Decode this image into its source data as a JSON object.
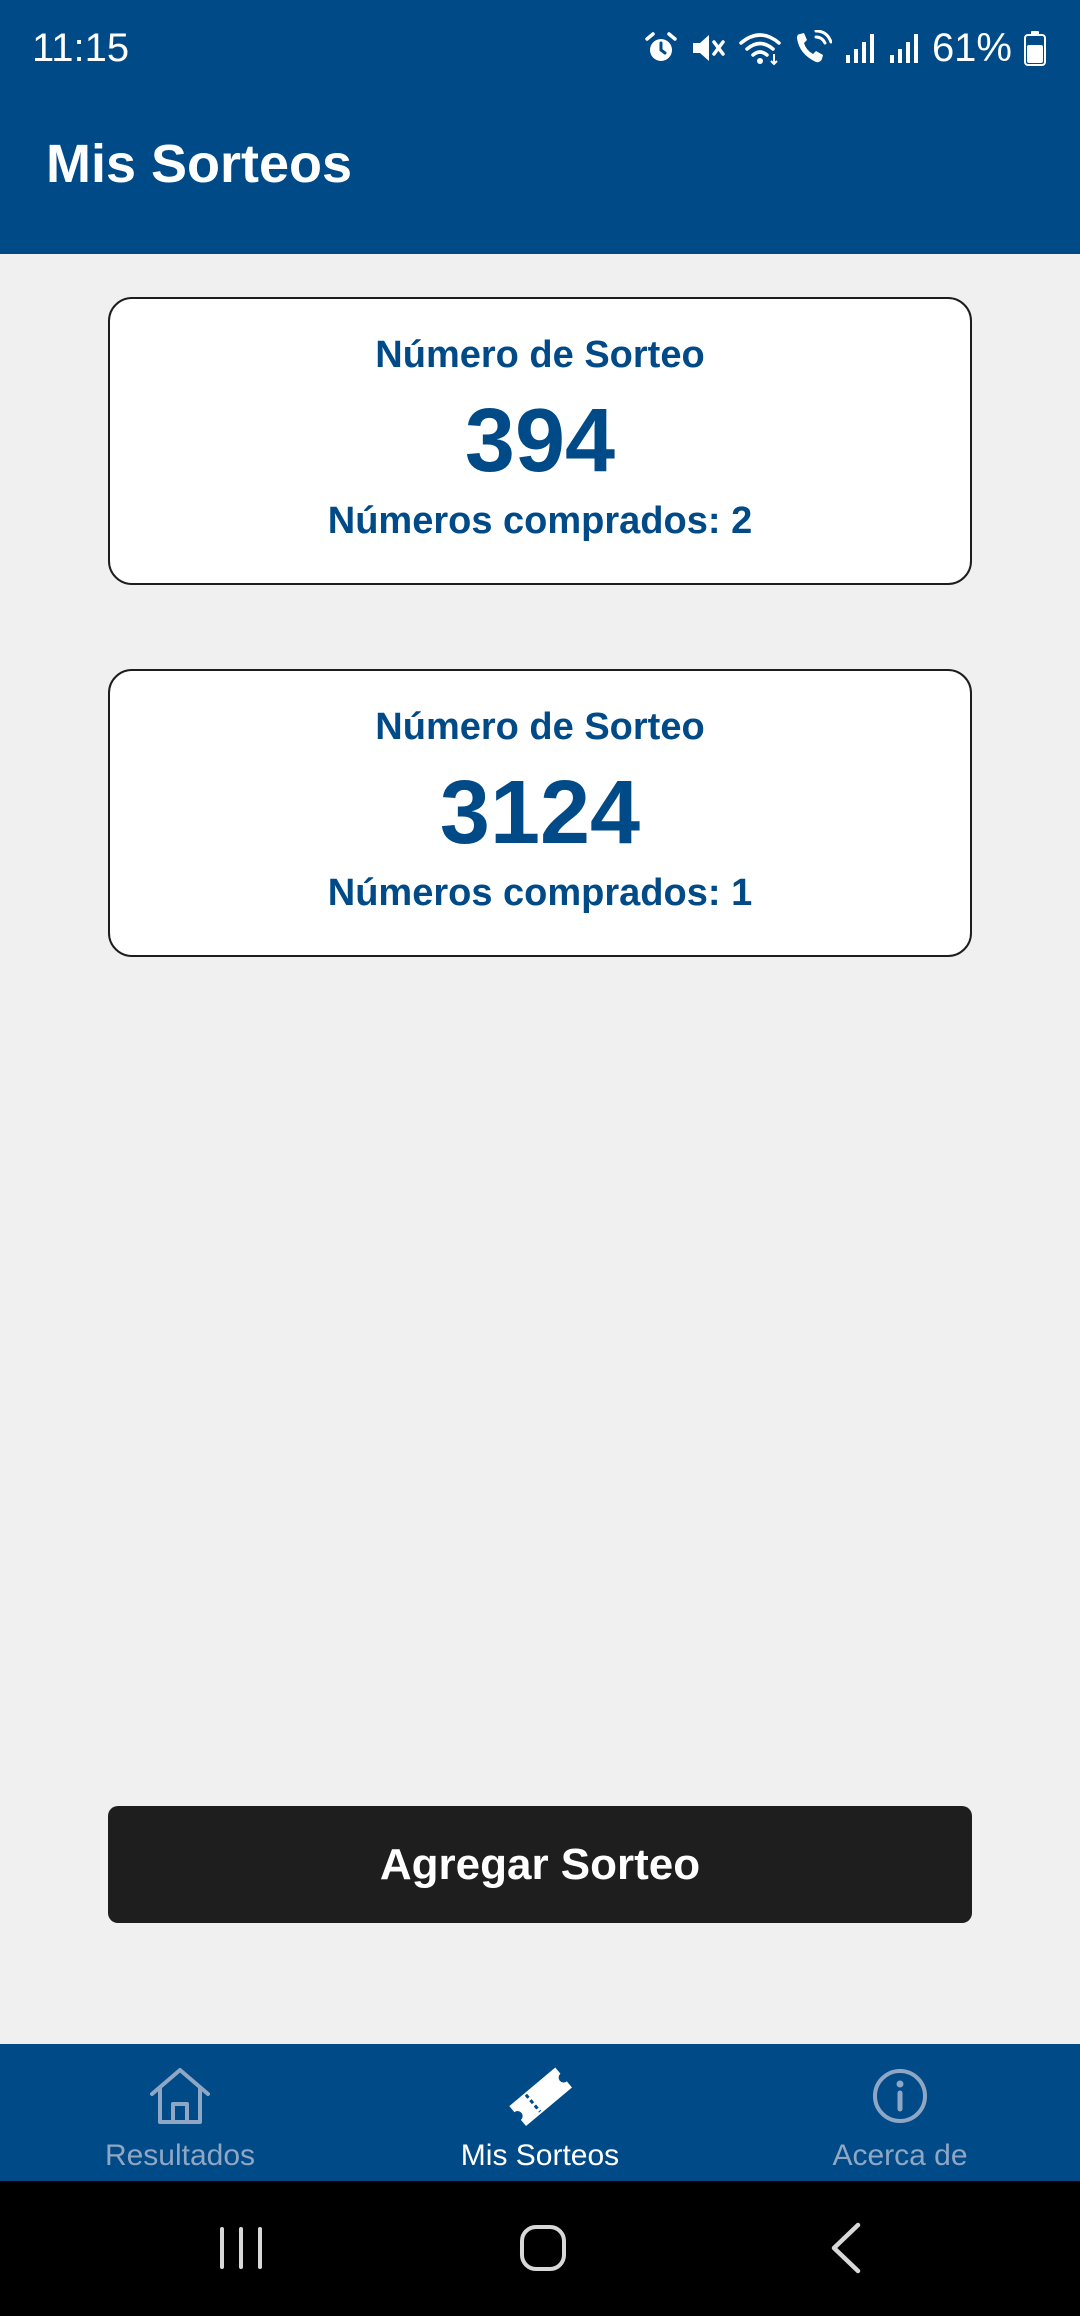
{
  "status_bar": {
    "time": "11:15",
    "battery_percent": "61%",
    "icons": [
      "alarm-icon",
      "mute-icon",
      "wifi-icon",
      "wifi-calling-icon",
      "signal-icon",
      "signal-icon",
      "battery-icon"
    ]
  },
  "app_bar": {
    "title": "Mis Sorteos"
  },
  "raffles": [
    {
      "label": "Número de Sorteo",
      "number": "394",
      "bought": "Números comprados: 2"
    },
    {
      "label": "Número de Sorteo",
      "number": "3124",
      "bought": "Números comprados: 1"
    }
  ],
  "add_button": {
    "label": "Agregar Sorteo"
  },
  "bottom_nav": {
    "items": [
      {
        "label": "Resultados",
        "icon": "home-icon",
        "active": false
      },
      {
        "label": "Mis Sorteos",
        "icon": "ticket-icon",
        "active": true
      },
      {
        "label": "Acerca de",
        "icon": "info-icon",
        "active": false
      }
    ]
  },
  "system_nav": {
    "buttons": [
      "recent-apps-icon",
      "home-button-icon",
      "back-icon"
    ]
  },
  "colors": {
    "primary": "#004a87",
    "background": "#f0f0f0",
    "card": "#ffffff",
    "button": "#1e1e1e",
    "nav_inactive": "#8fa7c4"
  }
}
